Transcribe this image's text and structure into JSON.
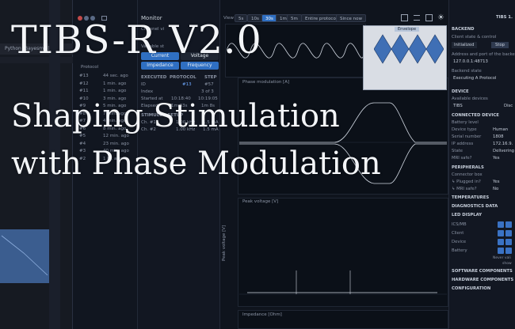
{
  "left_app": {
    "tab_label": "Python (Bayesmol)"
  },
  "protocol_panel": {
    "rows": [
      {
        "id": "#13",
        "time": "44 sec. ago"
      },
      {
        "id": "#12",
        "time": "1 min. ago"
      },
      {
        "id": "#11",
        "time": "1 min. ago"
      },
      {
        "id": "#10",
        "time": "3 min. ago"
      },
      {
        "id": "#9",
        "time": "5 min. ago"
      },
      {
        "id": "#8",
        "time": "7 min. ago"
      },
      {
        "id": "#7",
        "time": "4 min. ago"
      },
      {
        "id": "#6",
        "time": "8 min. ago"
      },
      {
        "id": "#5",
        "time": "12 min. ago"
      },
      {
        "id": "#4",
        "time": "23 min. ago"
      },
      {
        "id": "#3",
        "time": "40 min. ago"
      },
      {
        "id": "#2",
        "time": "1 hr. ago"
      }
    ],
    "protocol_label": "Protocol"
  },
  "monitor": {
    "title": "Monitor",
    "channel_label": "Channel vi",
    "variable_label": "Variable st",
    "current_btn": "Current",
    "voltage_btn": "Voltage",
    "impedance_btn": "Impedance",
    "frequency_btn": "Frequency",
    "headers": [
      "EXECUTED",
      "PROTOCOL",
      "STEP"
    ],
    "id_label": "ID",
    "id_protocol": "#13",
    "id_step": "#57",
    "index_label": "Index",
    "index_value": "3 of 3",
    "started_label": "Started at",
    "started_value": "10:18:40",
    "started_step": "10:19:05",
    "elapsed_label": "Elapsed",
    "elapsed_value": "1m 33s",
    "elapsed_step": "1m 8s",
    "stim_label": "STIMULUS SETUP",
    "ch1_label": "Ch. #1",
    "ch1_freq": "1.00 kHz",
    "ch1_amp": "1.5 mA",
    "ch2_label": "Ch. #2",
    "ch2_freq": "1.00 kHz",
    "ch2_amp": "1.5 mA"
  },
  "toolbar": {
    "view_label": "View",
    "options": [
      "5s",
      "10s",
      "30s",
      "1m",
      "5m"
    ],
    "selected": "30s",
    "entire_protocol": "Entire protocol",
    "since_now": "Since now"
  },
  "plots": {
    "plot1_title": "Phase modulation [A]",
    "plot2_title": "Peak voltage [V]",
    "plot2_ylabel": "Peak voltage [V]",
    "plot3_title": "Impedance [Ohm]"
  },
  "envelope": {
    "title": "Envelope"
  },
  "right_panel": {
    "header": "TIBS 1.",
    "backend_label": "BACKEND",
    "client_label": "Client state & control",
    "initialized_value": "Initialized",
    "stop_btn": "Stop",
    "address_label": "Address and port of the backe",
    "address_value": "127.0.0.1:48713",
    "backend_state_label": "Backend state",
    "backend_state_value": "Executing A Protocol",
    "device_label": "DEVICE",
    "available_label": "Available devices",
    "device_select": "TIBS",
    "disc_btn": "Disc",
    "connected_label": "CONNECTED DEVICE",
    "battery_label": "Battery level",
    "device_type_label": "Device type",
    "device_type_value": "Human",
    "serial_label": "Serial number",
    "serial_value": "1808",
    "ip_label": "IP address",
    "ip_value": "172.16.9.",
    "state_label": "State",
    "state_value": "Delivering",
    "mri_label": "MRI safe?",
    "mri_value": "Yes",
    "peripherals_label": "PERIPHERALS",
    "connector_label": "Connector box",
    "plugged_label": "↳ Plugged in?",
    "plugged_value": "Yes",
    "mri2_label": "↳ MRI safe?",
    "mri2_value": "No",
    "temperatures_label": "TEMPERATURES",
    "diagnostics_label": "DIAGNOSTICS DATA",
    "led_label": "LED DISPLAY",
    "ics_label": "ICS/MB",
    "client2_label": "Client",
    "device2_label": "Device",
    "battery2_label": "Battery",
    "never_label": "Never vali",
    "show_label": "show",
    "software_label": "SOFTWARE COMPONENTS",
    "hardware_label": "HARDWARE COMPONENTS",
    "config_label": "CONFIGURATION"
  },
  "overlay": {
    "title": "TIBS-R V2.0",
    "subtitle_line1": "Shaping Stimulation",
    "subtitle_line2": "with Phase Modulation"
  },
  "colors": {
    "accent": "#2f6fc2",
    "background": "#0d1117",
    "overlay_text": "#f3f5f8"
  }
}
